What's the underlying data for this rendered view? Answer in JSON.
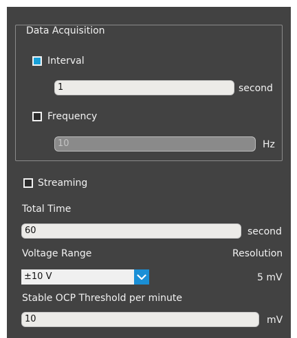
{
  "data_acquisition": {
    "legend": "Data Acquisition",
    "interval": {
      "label": "Interval",
      "checked": true,
      "value": "1",
      "unit": "second"
    },
    "frequency": {
      "label": "Frequency",
      "checked": false,
      "value": "10",
      "unit": "Hz"
    }
  },
  "streaming": {
    "label": "Streaming",
    "checked": false
  },
  "total_time": {
    "label": "Total Time",
    "value": "60",
    "unit": "second"
  },
  "voltage_range": {
    "label": "Voltage Range",
    "selected": "±10 V"
  },
  "resolution": {
    "label": "Resolution",
    "value": "5 mV"
  },
  "stable_ocp": {
    "label": "Stable OCP Threshold per minute",
    "value": "10",
    "unit": "mV"
  },
  "colors": {
    "panel": "#424242",
    "accent": "#1a8fd6",
    "input_bg": "#ecebe8"
  }
}
